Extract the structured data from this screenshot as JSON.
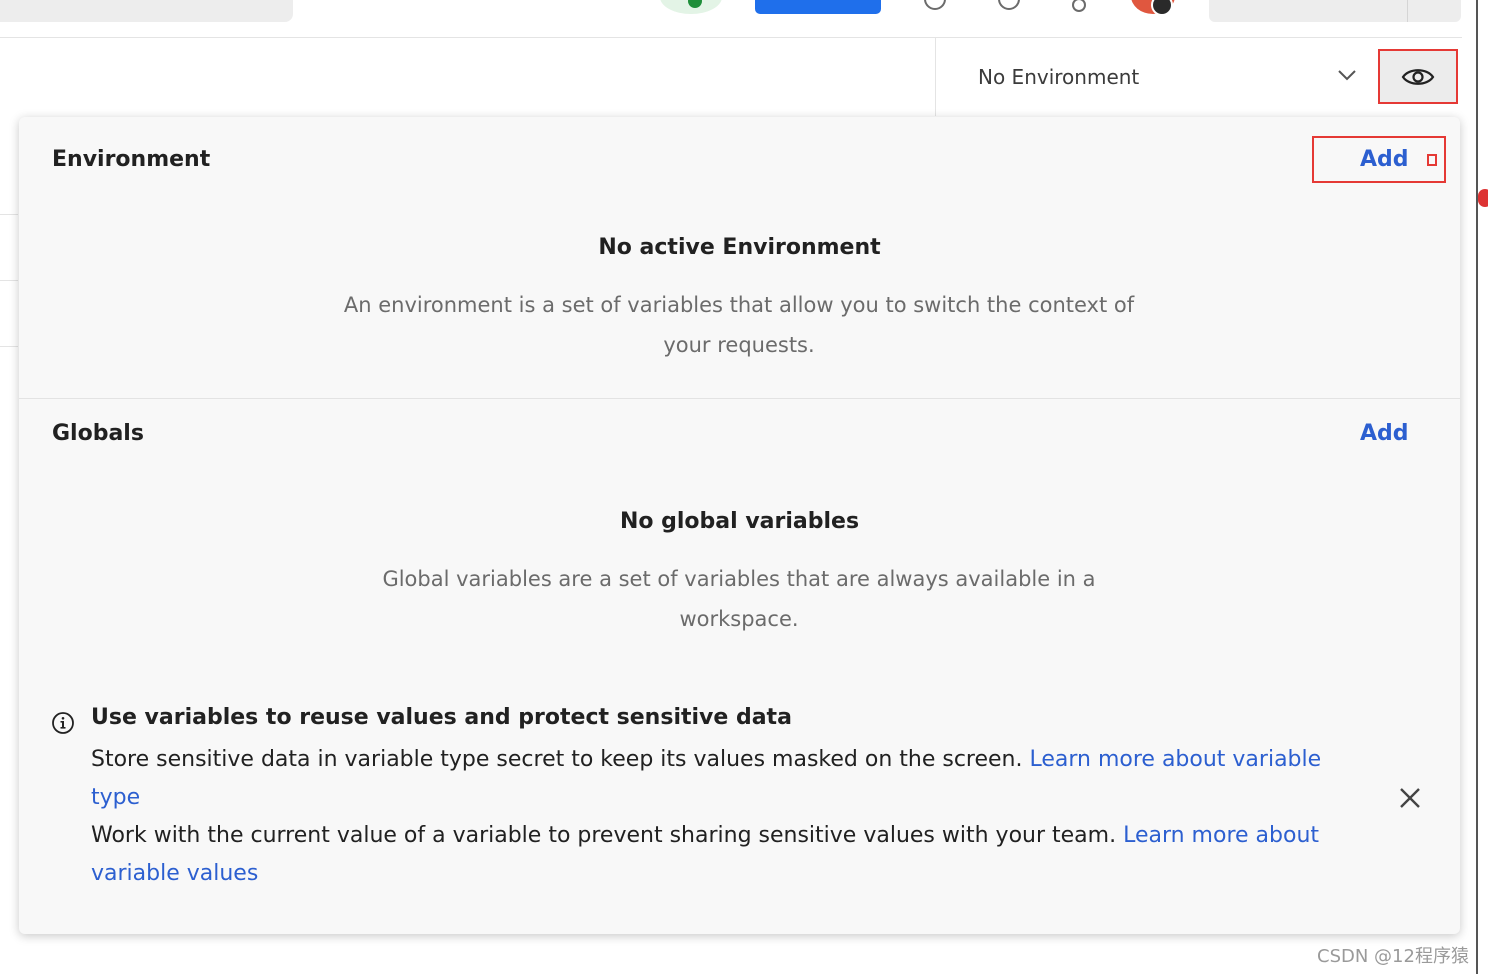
{
  "environment_selector": {
    "selected": "No Environment",
    "chevron_icon": "chevron-down-icon",
    "quick_look_icon": "eye-icon"
  },
  "popover": {
    "environment": {
      "title": "Environment",
      "add_label": "Add",
      "empty_title": "No active Environment",
      "empty_description": "An environment is a set of variables that allow you to switch the context of your requests."
    },
    "globals": {
      "title": "Globals",
      "add_label": "Add",
      "empty_title": "No global variables",
      "empty_description": "Global variables are a set of variables that are always available in a workspace."
    },
    "tip": {
      "icon": "info-icon",
      "title": "Use variables to reuse values and protect sensitive data",
      "line1_text": "Store sensitive data in variable type secret to keep its values masked on the screen. ",
      "line1_link": "Learn more about variable type",
      "line2_text": "Work with the current value of a variable to prevent sharing sensitive values with your team. ",
      "line2_link": "Learn more about variable values",
      "close_icon": "close-icon"
    }
  },
  "watermark": "CSDN @12程序猿",
  "colors": {
    "link": "#2c5fd0",
    "highlight": "#e53935",
    "popover_bg": "#f8f8f8"
  }
}
